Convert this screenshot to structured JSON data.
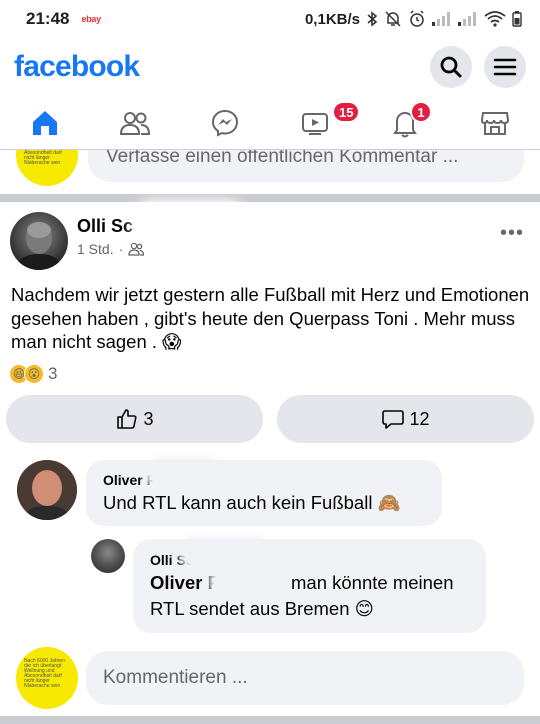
{
  "status": {
    "time": "21:48",
    "app_badge": "ebay",
    "speed": "0,1KB/s"
  },
  "header": {
    "logo": "facebook"
  },
  "nav": {
    "watch_badge": "15",
    "notifications_badge": "1"
  },
  "prev_comment": {
    "placeholder": "Verfasse einen öffentlichen Kommentar ...",
    "avatar_text": "Nach 6000 Jahren der ich überlangt Wellnung und Abesondheit darf nicht länger Nlaberache sein"
  },
  "post": {
    "author": "Olli Sc",
    "time": "1 Std.",
    "separator": "·",
    "text": "Nachdem wir jetzt gestern alle Fußball mit Herz und Emotionen gesehen haben , gibt's heute den Querpass Toni . Mehr muss man nicht sagen . 😱",
    "reaction_count": "3",
    "like_count": "3",
    "comment_count": "12"
  },
  "comments": [
    {
      "author": "Oliver F",
      "text": "Und RTL kann auch kein Fußball 🙈"
    },
    {
      "author": "Olli Sc",
      "mention": "Oliver F",
      "text": "man könnte meinen",
      "text2": "RTL sendet aus Bremen 😊"
    }
  ],
  "compose": {
    "placeholder": "Kommentieren ...",
    "avatar_text": "Nach 6000 Jahren der ich überlangt Wellnung und Abesondheit darf nicht länger Nlaberache sein"
  },
  "colors": {
    "brand": "#1877f2",
    "badge": "#e41e3f",
    "bubble": "#f0f2f5",
    "divider": "#c9ccd1"
  }
}
